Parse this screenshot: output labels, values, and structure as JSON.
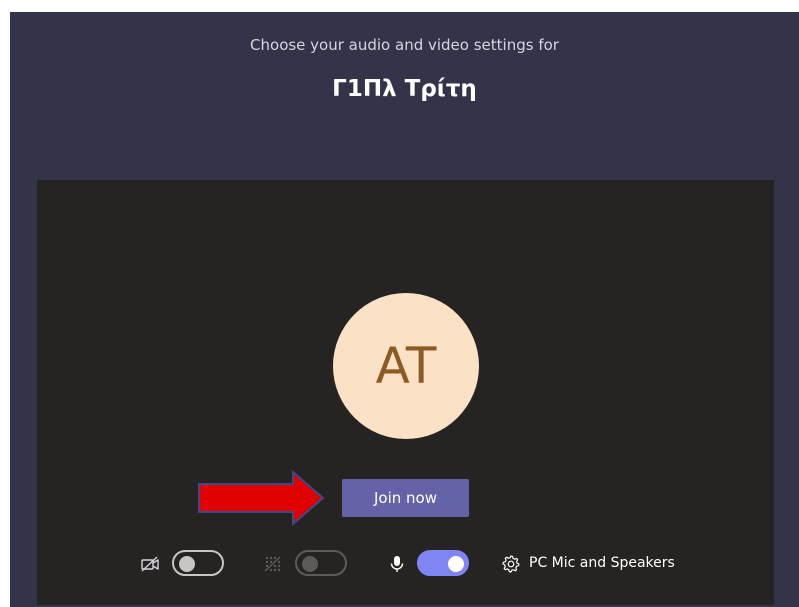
{
  "header": {
    "subtitle": "Choose your audio and video settings for",
    "meeting_title": "Γ1Πλ Τρίτη"
  },
  "preview": {
    "avatar_initials": "AT",
    "join_label": "Join now"
  },
  "controls": {
    "camera": {
      "icon": "camera-off-icon",
      "state": "off"
    },
    "background_blur": {
      "icon": "background-blur-icon",
      "state": "off",
      "enabled": false
    },
    "microphone": {
      "icon": "microphone-icon",
      "state": "on"
    },
    "audio_settings": {
      "icon": "gear-icon",
      "label": "PC Mic and Speakers"
    }
  },
  "annotation": {
    "icon": "red-arrow-icon",
    "color": "#e00000"
  },
  "colors": {
    "panel_bg": "#33344a",
    "preview_bg": "#252423",
    "accent": "#6264a7",
    "toggle_on": "#7f85f5",
    "avatar_bg": "#fbe2c6",
    "avatar_text": "#8c5a23"
  }
}
